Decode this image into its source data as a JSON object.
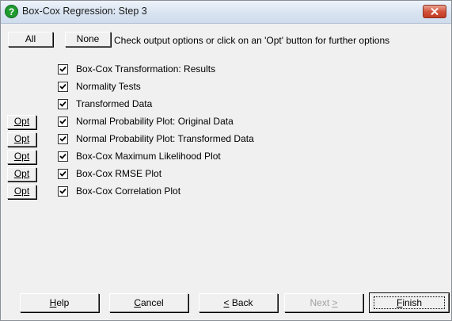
{
  "window": {
    "title": "Box-Cox Regression: Step 3",
    "icon": "help-question-icon"
  },
  "toolbar": {
    "all_label": "All",
    "none_label": "None",
    "instruction": "Check output options or click on an 'Opt' button for further options"
  },
  "options": [
    {
      "label": "Box-Cox Transformation: Results",
      "checked": true,
      "has_opt": false
    },
    {
      "label": "Normality Tests",
      "checked": true,
      "has_opt": false
    },
    {
      "label": "Transformed Data",
      "checked": true,
      "has_opt": false
    },
    {
      "label": "Normal Probability Plot: Original Data",
      "checked": true,
      "has_opt": true
    },
    {
      "label": "Normal Probability Plot: Transformed Data",
      "checked": true,
      "has_opt": true
    },
    {
      "label": "Box-Cox Maximum Likelihood Plot",
      "checked": true,
      "has_opt": true
    },
    {
      "label": "Box-Cox RMSE Plot",
      "checked": true,
      "has_opt": true
    },
    {
      "label": "Box-Cox Correlation Plot",
      "checked": true,
      "has_opt": true
    }
  ],
  "opt_label": "Opt",
  "footer": {
    "help": {
      "mnemonic": "H",
      "rest": "elp"
    },
    "cancel": {
      "mnemonic": "C",
      "rest": "ancel"
    },
    "back": {
      "mnemonic": "<",
      "rest": " Back"
    },
    "next": {
      "rest": "Next ",
      "mnemonic": ">"
    },
    "finish": {
      "mnemonic": "F",
      "rest": "inish"
    }
  },
  "colors": {
    "face": "#f0f0f0",
    "close_red": "#c23b22",
    "disabled_text": "#a0a0a0"
  }
}
